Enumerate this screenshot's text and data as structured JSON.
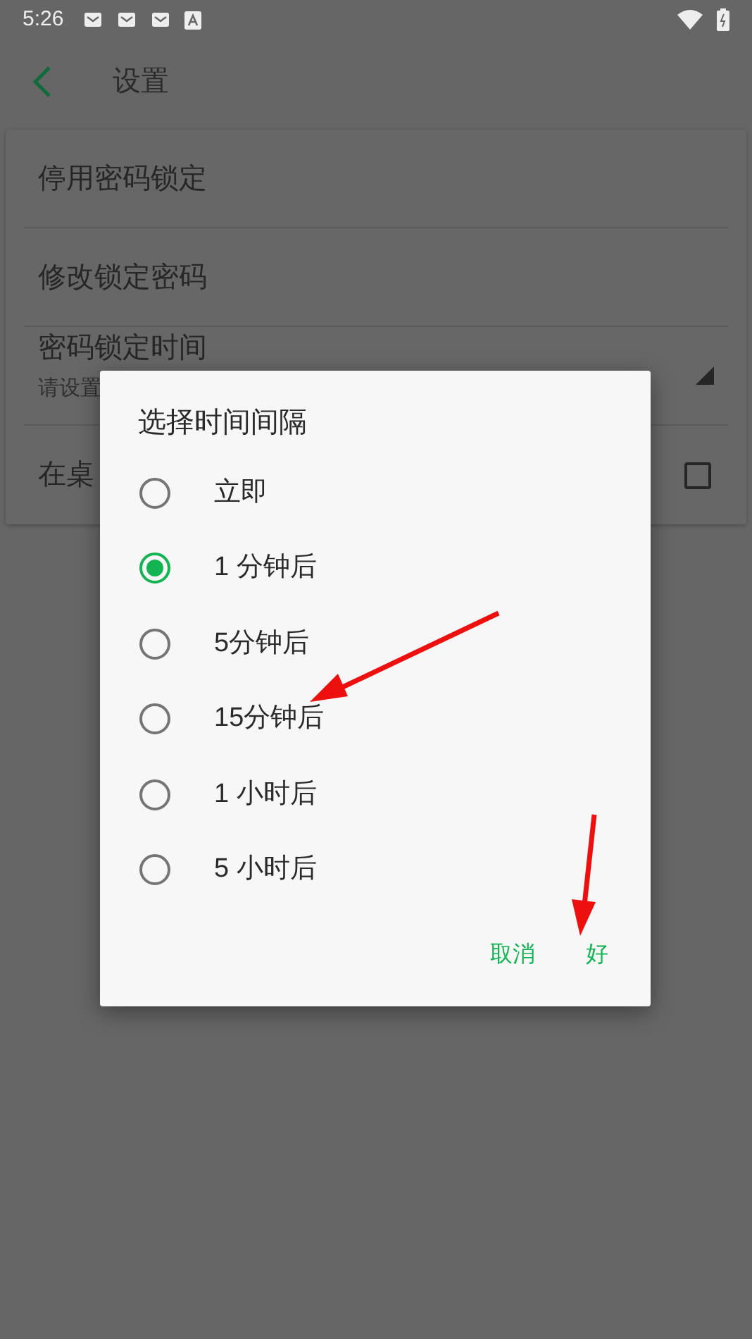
{
  "status_bar": {
    "time": "5:26"
  },
  "toolbar": {
    "title": "设置"
  },
  "settings": [
    {
      "kind": "plain",
      "title": "停用密码锁定"
    },
    {
      "kind": "plain",
      "title": "修改锁定密码"
    },
    {
      "kind": "dropdown",
      "title": "密码锁定时间",
      "subtitle": "请设置"
    },
    {
      "kind": "checkbox",
      "title": "在桌",
      "checked": false
    }
  ],
  "dialog": {
    "title": "选择时间间隔",
    "options": [
      {
        "label": "立即",
        "selected": false
      },
      {
        "label": "1 分钟后",
        "selected": true
      },
      {
        "label": "5分钟后",
        "selected": false
      },
      {
        "label": "15分钟后",
        "selected": false
      },
      {
        "label": "1 小时后",
        "selected": false
      },
      {
        "label": "5 小时后",
        "selected": false
      }
    ],
    "buttons": [
      "取消",
      "好"
    ]
  }
}
